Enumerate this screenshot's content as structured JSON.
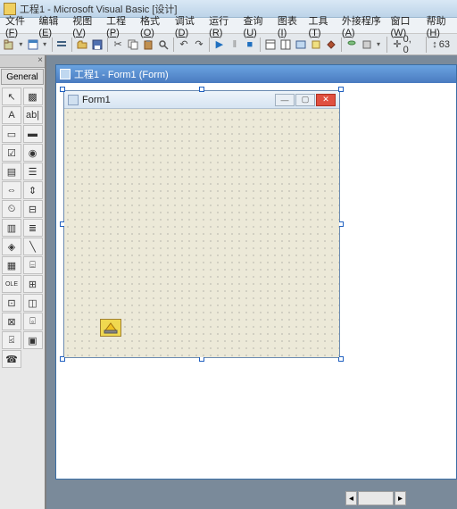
{
  "app": {
    "title": "工程1 - Microsoft Visual Basic [设计]"
  },
  "menu": {
    "items": [
      {
        "label": "文件",
        "key": "F"
      },
      {
        "label": "编辑",
        "key": "E"
      },
      {
        "label": "视图",
        "key": "V"
      },
      {
        "label": "工程",
        "key": "P"
      },
      {
        "label": "格式",
        "key": "O"
      },
      {
        "label": "调试",
        "key": "D"
      },
      {
        "label": "运行",
        "key": "R"
      },
      {
        "label": "查询",
        "key": "U"
      },
      {
        "label": "图表",
        "key": "I"
      },
      {
        "label": "工具",
        "key": "T"
      },
      {
        "label": "外接程序",
        "key": "A"
      },
      {
        "label": "窗口",
        "key": "W"
      },
      {
        "label": "帮助",
        "key": "H"
      }
    ]
  },
  "toolbar": {
    "coords": "0, 0",
    "size_caret": "↕",
    "size_value": "63"
  },
  "toolbox": {
    "close": "×",
    "tab": "General",
    "items": [
      "pointer-icon",
      "picturebox-icon",
      "label-icon",
      "textbox-icon",
      "frame-icon",
      "commandbutton-icon",
      "checkbox-icon",
      "optionbutton-icon",
      "combobox-icon",
      "listbox-icon",
      "hscrollbar-icon",
      "vscrollbar-icon",
      "timer-icon",
      "drivelistbox-icon",
      "dirlistbox-icon",
      "filelistbox-icon",
      "shape-icon",
      "line-icon",
      "image-icon",
      "data-icon",
      "ole-icon",
      "user1-icon",
      "user2-icon",
      "user3-icon",
      "user4-icon",
      "user5-icon",
      "user6-icon",
      "user7-icon",
      "user8-icon",
      ""
    ]
  },
  "mdi": {
    "title": "工程1 - Form1 (Form)"
  },
  "form": {
    "caption": "Form1"
  },
  "control": {
    "name": "user-control"
  }
}
